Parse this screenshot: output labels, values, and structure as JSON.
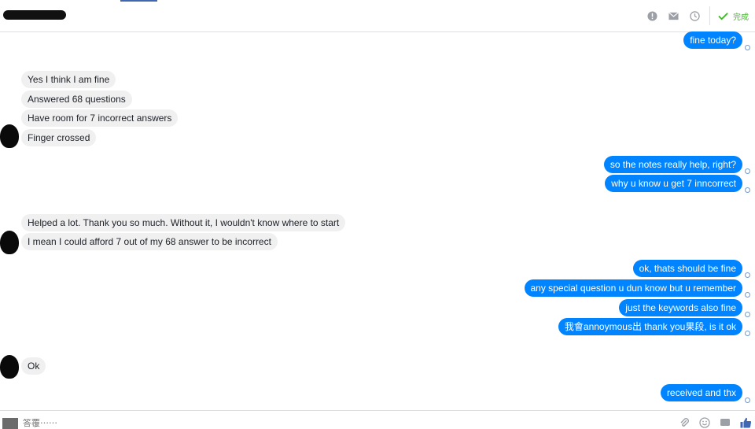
{
  "header": {
    "done_label": "完成",
    "icons": [
      "info-icon",
      "mail-icon",
      "clock-icon",
      "checkmark-icon"
    ]
  },
  "conversation": {
    "messages": [
      {
        "side": "out",
        "text": "fine today?"
      },
      {
        "side": "in",
        "text": "Yes I think I am fine"
      },
      {
        "side": "in",
        "text": "Answered 68 questions"
      },
      {
        "side": "in",
        "text": "Have room for 7 incorrect answers"
      },
      {
        "side": "in",
        "text": "Finger crossed"
      },
      {
        "side": "out",
        "text": "so the notes really help, right?"
      },
      {
        "side": "out",
        "text": "why u know u get 7 inncorrect"
      },
      {
        "side": "in",
        "text": "Helped a lot. Thank you so much. Without it, I wouldn't know where to start"
      },
      {
        "side": "in",
        "text": "I mean I could afford 7 out of my 68 answer to be incorrect"
      },
      {
        "side": "out",
        "text": "ok, thats should be fine"
      },
      {
        "side": "out",
        "text": "any special question u dun know but u remember"
      },
      {
        "side": "out",
        "text": "just the keywords also fine"
      },
      {
        "side": "out",
        "text": "我會annoymous出 thank you果段, is it ok"
      },
      {
        "side": "in",
        "text": "Ok"
      },
      {
        "side": "out",
        "text": "received and thx"
      }
    ]
  },
  "composer": {
    "placeholder": "答覆⋯⋯"
  },
  "footer": {
    "icons": [
      "attachment-icon",
      "emoji-icon",
      "camera-icon",
      "thumbs-up-icon"
    ]
  },
  "colors": {
    "outgoing_bubble": "#0084ff",
    "incoming_bubble": "#f1f0f0",
    "done_green": "#42b72a"
  }
}
